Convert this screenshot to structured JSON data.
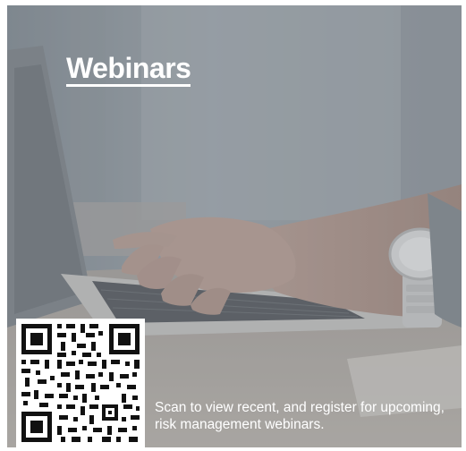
{
  "promo": {
    "title": "Webinars",
    "caption": "Scan to view recent, and register for upcoming, risk management webinars."
  },
  "colors": {
    "overlay": "#8f969b",
    "text": "#ffffff"
  },
  "icons": {
    "qr": "qr-code-icon"
  }
}
